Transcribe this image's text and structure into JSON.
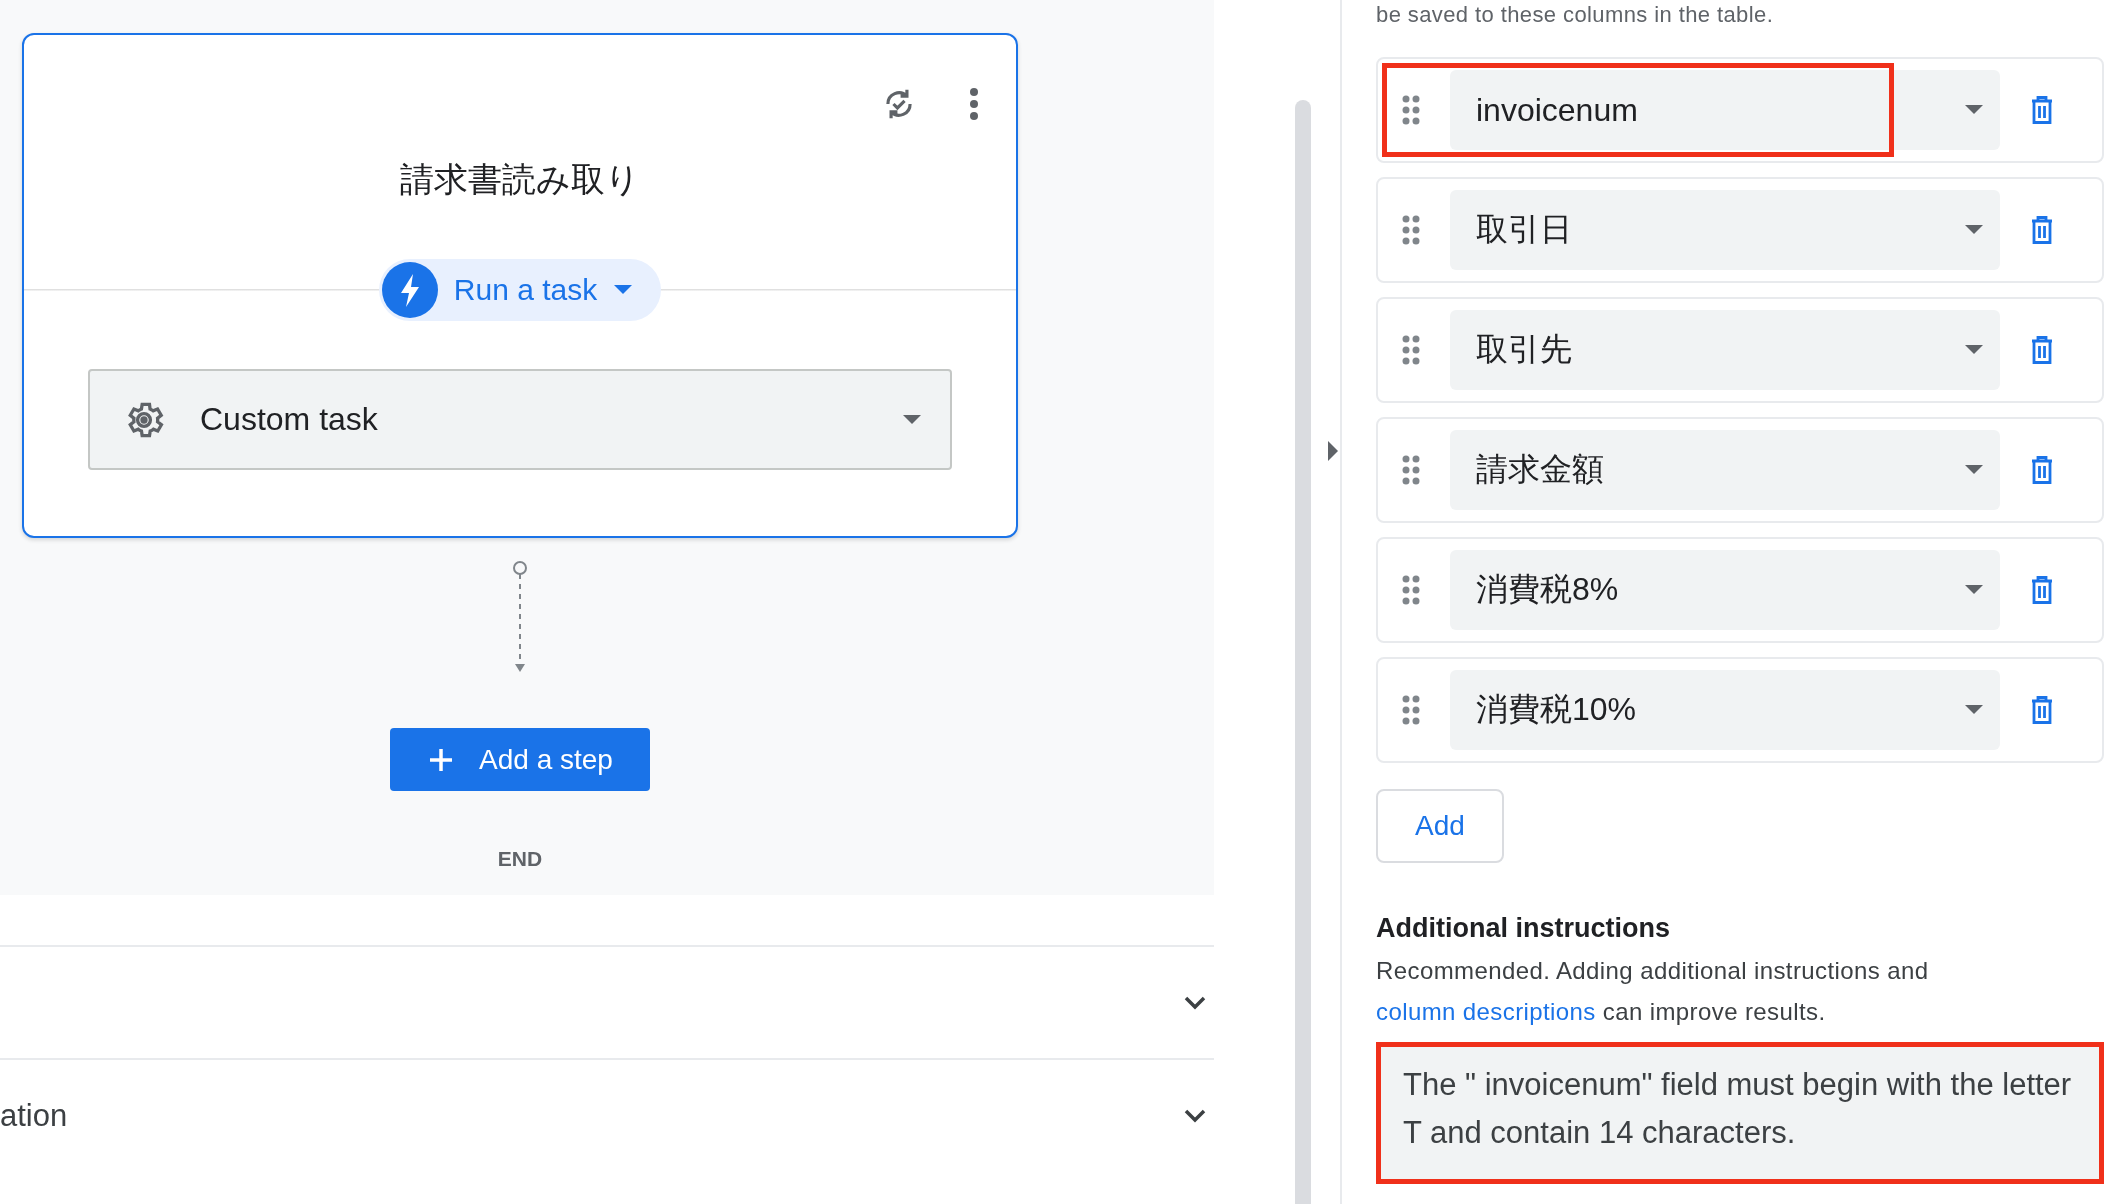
{
  "flow_card": {
    "title": "請求書読み取り",
    "action_chip": {
      "label": "Run a task"
    },
    "task_select": {
      "value": "Custom task"
    }
  },
  "add_step_button": {
    "label": "Add a step"
  },
  "end_label": "END",
  "sections": [
    {
      "expanded": false
    },
    {
      "title": "ation",
      "expanded": false
    }
  ],
  "side_panel": {
    "collapsed": true
  },
  "right_panel": {
    "intro_text": "be saved to these columns in the table.",
    "columns": [
      {
        "value": "invoicenum",
        "highlighted": true
      },
      {
        "value": "取引日",
        "highlighted": false
      },
      {
        "value": "取引先",
        "highlighted": false
      },
      {
        "value": "請求金額",
        "highlighted": false
      },
      {
        "value": "消費税8%",
        "highlighted": false
      },
      {
        "value": "消費税10%",
        "highlighted": false
      }
    ],
    "add_button": "Add",
    "instructions": {
      "heading": "Additional instructions",
      "description": [
        {
          "kind": "text",
          "text": "Recommended. Adding additional instructions and "
        },
        {
          "kind": "link",
          "text": "column descriptions"
        },
        {
          "kind": "text",
          "text": " can improve results."
        }
      ],
      "value": "The \" invoicenum\" field must begin with the letter T and contain 14 characters.",
      "highlighted": true
    }
  }
}
